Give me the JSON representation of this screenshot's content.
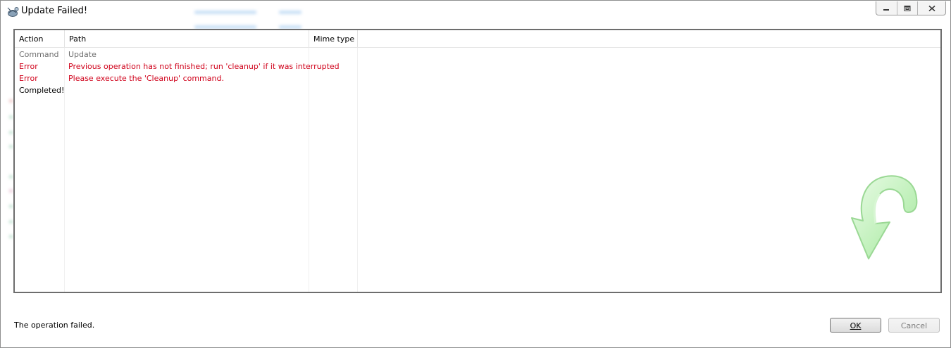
{
  "window": {
    "title": "Update Failed!"
  },
  "log_table": {
    "columns": [
      "Action",
      "Path",
      "Mime type"
    ],
    "rows": [
      {
        "action": "Command",
        "path": "Update",
        "mime": "",
        "status": "info"
      },
      {
        "action": "Error",
        "path": "Previous operation has not finished; run 'cleanup' if it was interrupted",
        "mime": "",
        "status": "error"
      },
      {
        "action": "Error",
        "path": "Please execute the 'Cleanup' command.",
        "mime": "",
        "status": "error"
      },
      {
        "action": "Completed!",
        "path": "",
        "mime": "",
        "status": "done"
      }
    ]
  },
  "status_bar": {
    "message": "The operation failed."
  },
  "buttons": {
    "ok": "OK",
    "cancel": "Cancel"
  },
  "colors": {
    "error": "#d0021b",
    "info": "#6d6d6d",
    "done": "#000000",
    "arrow": "#b9efb4"
  },
  "icons": {
    "app": "tortoisesvn-icon",
    "minimize": "minimize-icon",
    "restore": "restore-icon",
    "close": "close-icon",
    "decoration": "green-update-arrow-icon"
  }
}
